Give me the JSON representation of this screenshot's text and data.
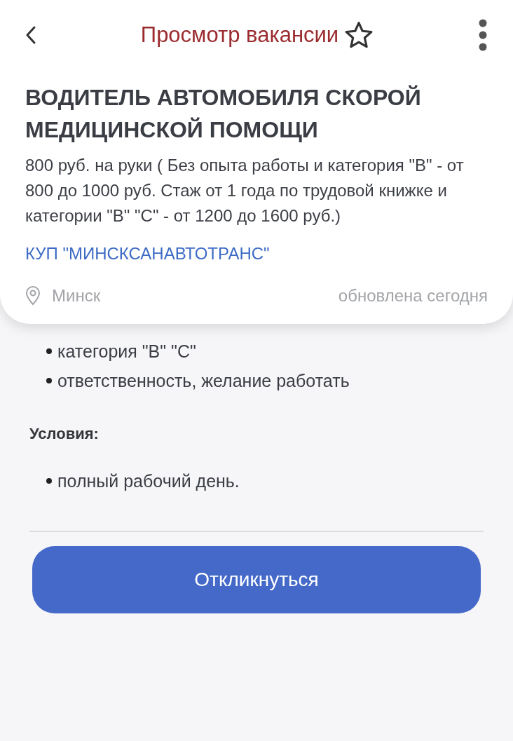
{
  "header": {
    "title": "Просмотр вакансии",
    "favorite": false
  },
  "vacancy": {
    "title": "ВОДИТЕЛЬ АВТОМОБИЛЯ СКОРОЙ МЕДИЦИНСКОЙ ПОМОЩИ",
    "salary": "800 руб. на руки ( Без опыта работы и категория \"В\" - от 800 до 1000 руб. Стаж от 1 года по трудовой книжке и категории \"В\" \"С\" - от 1200 до 1600 руб.)",
    "company": "КУП \"МИНСКСАНАВТОТРАНС\"",
    "location": "Минск",
    "updated": "обновлена сегодня"
  },
  "requirements": [
    "категория \"В\" \"С\"",
    "ответственность, желание работать"
  ],
  "conditions": {
    "heading": "Условия:",
    "items": [
      "полный рабочий день."
    ]
  },
  "apply_button": "Откликнуться"
}
